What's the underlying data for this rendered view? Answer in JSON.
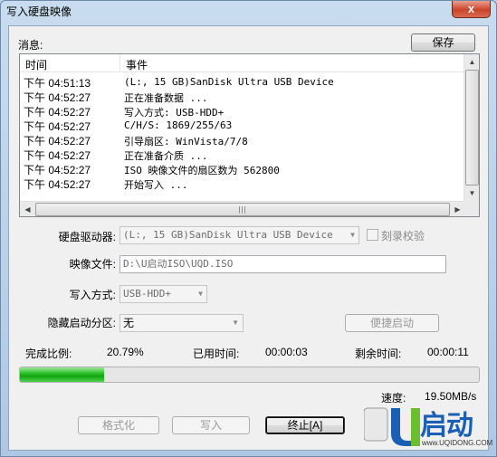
{
  "window": {
    "title": "写入硬盘映像",
    "close_label": "x"
  },
  "message": {
    "label": "消息:",
    "save_button": "保存"
  },
  "log": {
    "columns": [
      "时间",
      "事件"
    ],
    "rows": [
      {
        "time": "下午 04:51:13",
        "event": "(L:, 15 GB)SanDisk Ultra USB Device"
      },
      {
        "time": "下午 04:52:27",
        "event": "正在准备数据 ..."
      },
      {
        "time": "下午 04:52:27",
        "event": "写入方式: USB-HDD+"
      },
      {
        "time": "下午 04:52:27",
        "event": "C/H/S: 1869/255/63"
      },
      {
        "time": "下午 04:52:27",
        "event": "引导扇区: WinVista/7/8"
      },
      {
        "time": "下午 04:52:27",
        "event": "正在准备介质 ..."
      },
      {
        "time": "下午 04:52:27",
        "event": "ISO 映像文件的扇区数为 562800"
      },
      {
        "time": "下午 04:52:27",
        "event": "开始写入 ..."
      }
    ]
  },
  "form": {
    "drive_label": "硬盘驱动器:",
    "drive_value": "(L:, 15 GB)SanDisk Ultra USB Device",
    "verify_label": "刻录校验",
    "image_label": "映像文件:",
    "image_value": "D:\\U启动ISO\\UQD.ISO",
    "write_mode_label": "写入方式:",
    "write_mode_value": "USB-HDD+",
    "hidden_partition_label": "隐藏启动分区:",
    "hidden_partition_value": "无",
    "quick_boot_button": "便捷启动"
  },
  "status": {
    "progress_label": "完成比例:",
    "progress_value": "20.79%",
    "progress_fraction": 0.183,
    "elapsed_label": "已用时间:",
    "elapsed_value": "00:00:03",
    "remaining_label": "剩余时间:",
    "remaining_value": "00:00:11",
    "speed_label": "速度:",
    "speed_value": "19.50MB/s"
  },
  "buttons": {
    "format": "格式化",
    "write": "写入",
    "stop": "终止[A]"
  },
  "logo": {
    "text": "启动",
    "url": "www.UQIDONG.COM"
  },
  "colors": {
    "progress_green": "#12a30f",
    "logo_blue": "#1a5fb4"
  }
}
